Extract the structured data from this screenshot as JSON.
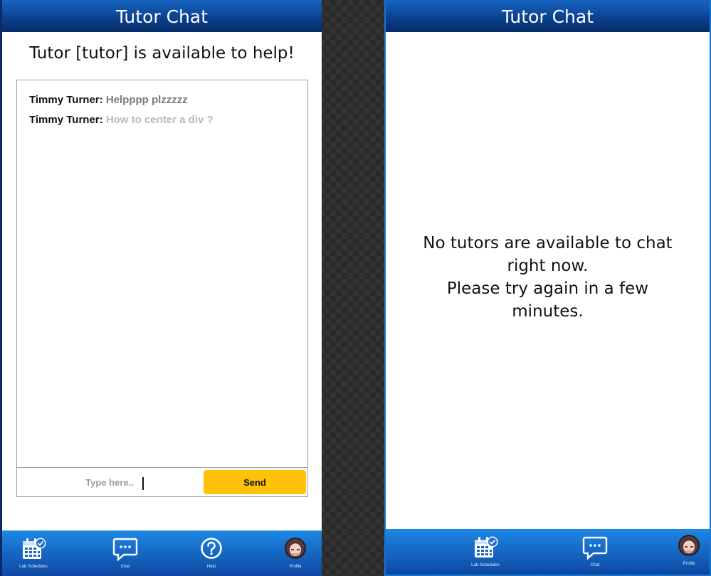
{
  "left_screen": {
    "header_title": "Tutor Chat",
    "tutor_status": "Tutor [tutor] is available to help!",
    "messages": [
      {
        "sender": "Timmy Turner:",
        "text": "Helpppp plzzzzz"
      },
      {
        "sender": "Timmy Turner:",
        "text": "How to center a div ?"
      }
    ],
    "input": {
      "placeholder": "Type here..",
      "value": ""
    },
    "send_label": "Send",
    "tabs": [
      {
        "label": "Lab Schedules",
        "icon": "calendar-check-icon"
      },
      {
        "label": "Chat",
        "icon": "chat-bubble-icon"
      },
      {
        "label": "Help",
        "icon": "question-circle-icon"
      },
      {
        "label": "Profile",
        "icon": "avatar-icon"
      }
    ]
  },
  "right_screen": {
    "header_title": "Tutor Chat",
    "empty_message_lines": [
      "No tutors are available to chat",
      "right now.",
      "Please try again in a few",
      "minutes."
    ],
    "tabs": [
      {
        "label": "Lab Schedules",
        "icon": "calendar-check-icon"
      },
      {
        "label": "Chat",
        "icon": "chat-bubble-icon"
      },
      {
        "label": "Profile",
        "icon": "avatar-icon"
      }
    ]
  },
  "colors": {
    "header_blue": "#0b3f8c",
    "tabbar_blue": "#1565c0",
    "send_yellow": "#ffc107",
    "checkmark_blue": "#1e6fd9"
  }
}
